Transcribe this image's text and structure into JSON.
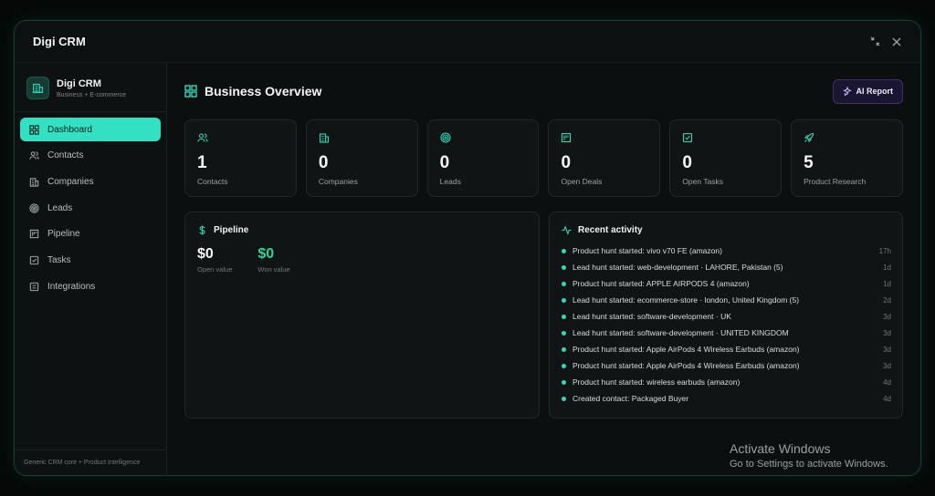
{
  "window": {
    "title": "Digi CRM"
  },
  "brand": {
    "name": "Digi CRM",
    "subtitle": "Business + E-commerce"
  },
  "nav": [
    {
      "label": "Dashboard",
      "icon": "grid-icon",
      "active": true
    },
    {
      "label": "Contacts",
      "icon": "users-icon"
    },
    {
      "label": "Companies",
      "icon": "building-icon"
    },
    {
      "label": "Leads",
      "icon": "target-icon"
    },
    {
      "label": "Pipeline",
      "icon": "kanban-icon"
    },
    {
      "label": "Tasks",
      "icon": "check-square-icon"
    },
    {
      "label": "Integrations",
      "icon": "plug-icon"
    }
  ],
  "sidebar_footer": "Generic CRM core + Product Intelligence",
  "header": {
    "title": "Business Overview",
    "ai_button": "AI Report"
  },
  "stats": [
    {
      "value": "1",
      "label": "Contacts",
      "icon": "users-icon"
    },
    {
      "value": "0",
      "label": "Companies",
      "icon": "building-icon"
    },
    {
      "value": "0",
      "label": "Leads",
      "icon": "target-icon"
    },
    {
      "value": "0",
      "label": "Open Deals",
      "icon": "kanban-icon"
    },
    {
      "value": "0",
      "label": "Open Tasks",
      "icon": "check-square-icon"
    },
    {
      "value": "5",
      "label": "Product Research",
      "icon": "rocket-icon"
    }
  ],
  "pipeline": {
    "title": "Pipeline",
    "open_value": "$0",
    "open_label": "Open value",
    "won_value": "$0",
    "won_label": "Won value"
  },
  "activity": {
    "title": "Recent activity",
    "items": [
      {
        "text": "Product hunt started: vivo v70 FE (amazon)",
        "time": "17h"
      },
      {
        "text": "Lead hunt started: web-development · LAHORE, Pakistan (5)",
        "time": "1d"
      },
      {
        "text": "Product hunt started: APPLE AIRPODS 4 (amazon)",
        "time": "1d"
      },
      {
        "text": "Lead hunt started: ecommerce-store · london, United Kingdom (5)",
        "time": "2d"
      },
      {
        "text": "Lead hunt started: software-development · UK",
        "time": "3d"
      },
      {
        "text": "Lead hunt started: software-development · UNITED KINGDOM",
        "time": "3d"
      },
      {
        "text": "Product hunt started: Apple AirPods 4 Wireless Earbuds (amazon)",
        "time": "3d"
      },
      {
        "text": "Product hunt started: Apple AirPods 4 Wireless Earbuds (amazon)",
        "time": "3d"
      },
      {
        "text": "Product hunt started: wireless earbuds (amazon)",
        "time": "4d"
      },
      {
        "text": "Created contact: Packaged Buyer",
        "time": "4d"
      }
    ]
  },
  "watermark": {
    "line1": "Activate Windows",
    "line2": "Go to Settings to activate Windows."
  }
}
